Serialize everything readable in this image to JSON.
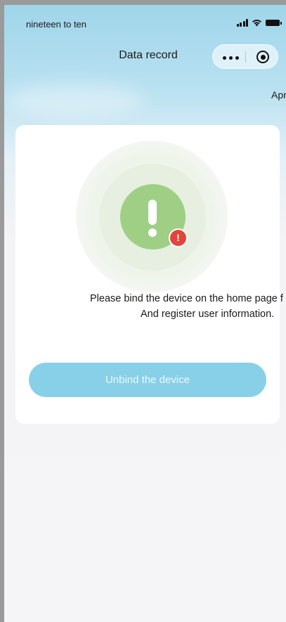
{
  "status_bar": {
    "time": "nineteen to ten"
  },
  "nav": {
    "title": "Data record"
  },
  "header": {
    "date_partial": "Apr"
  },
  "card": {
    "badge_symbol": "!",
    "message_line1": "Please bind the device on the home page f",
    "message_line2": "And register user information.",
    "unbind_label": "Unbind the device"
  },
  "colors": {
    "accent_blue": "#88d0e7",
    "success_green": "#9ecf85",
    "alert_red": "#e2453c"
  }
}
